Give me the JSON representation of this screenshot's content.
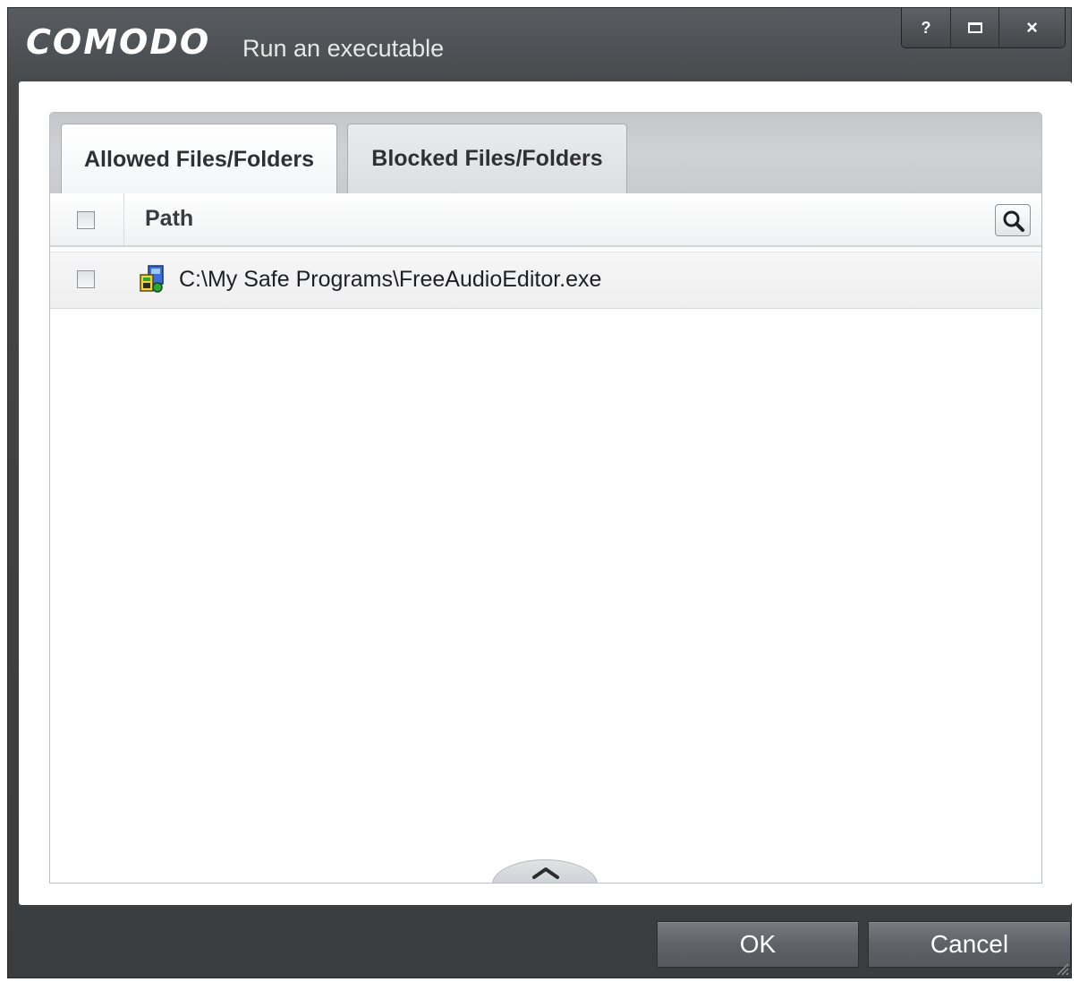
{
  "window": {
    "brand": "COMODO",
    "title": "Run an executable",
    "controls": {
      "help": "?",
      "maximize": "maximize-icon",
      "close": "×"
    }
  },
  "tabs": [
    {
      "label": "Allowed Files/Folders",
      "active": true
    },
    {
      "label": "Blocked Files/Folders",
      "active": false
    }
  ],
  "table": {
    "columns": [
      "Path"
    ],
    "rows": [
      {
        "icon": "executable-file-icon",
        "path": "C:\\My Safe Programs\\FreeAudioEditor.exe",
        "checked": false
      }
    ]
  },
  "buttons": {
    "ok": "OK",
    "cancel": "Cancel"
  },
  "colors": {
    "window_bg": "#404346",
    "button_bg": "#5f6367"
  }
}
